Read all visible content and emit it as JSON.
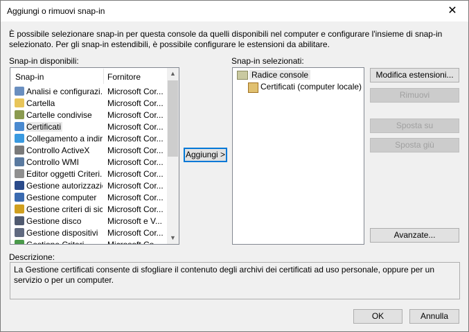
{
  "window": {
    "title": "Aggiungi o rimuovi snap-in",
    "close_glyph": "✕"
  },
  "intro_text": "È possibile selezionare snap-in per questa console da quelli disponibili nel computer e configurare l'insieme di snap-in selezionato. Per gli snap-in estendibili, è possibile configurare le estensioni da abilitare.",
  "available": {
    "label": "Snap-in disponibili:",
    "columns": [
      "Snap-in",
      "Fornitore"
    ],
    "rows": [
      {
        "name": "Analisi e configurazi...",
        "vendor": "Microsoft Cor...",
        "icon": "security-config-icon",
        "color": "#6a8fc0"
      },
      {
        "name": "Cartella",
        "vendor": "Microsoft Cor...",
        "icon": "folder-icon",
        "color": "#e8c55a"
      },
      {
        "name": "Cartelle condivise",
        "vendor": "Microsoft Cor...",
        "icon": "shared-folder-icon",
        "color": "#8a9a50"
      },
      {
        "name": "Certificati",
        "vendor": "Microsoft Cor...",
        "icon": "certificate-icon",
        "color": "#4a8ad0",
        "selected": true
      },
      {
        "name": "Collegamento a indir...",
        "vendor": "Microsoft Cor...",
        "icon": "web-link-icon",
        "color": "#3a9ae0"
      },
      {
        "name": "Controllo ActiveX",
        "vendor": "Microsoft Cor...",
        "icon": "activex-icon",
        "color": "#7a7a7a"
      },
      {
        "name": "Controllo WMI",
        "vendor": "Microsoft Cor...",
        "icon": "wmi-icon",
        "color": "#5a7aa0"
      },
      {
        "name": "Editor oggetti Criteri...",
        "vendor": "Microsoft Cor...",
        "icon": "policy-editor-icon",
        "color": "#909090"
      },
      {
        "name": "Gestione autorizzazioni",
        "vendor": "Microsoft Cor...",
        "icon": "authorization-icon",
        "color": "#2a4a8a"
      },
      {
        "name": "Gestione computer",
        "vendor": "Microsoft Cor...",
        "icon": "computer-management-icon",
        "color": "#3a6ab0"
      },
      {
        "name": "Gestione criteri di sic...",
        "vendor": "Microsoft Cor...",
        "icon": "security-policy-icon",
        "color": "#d0a020"
      },
      {
        "name": "Gestione disco",
        "vendor": "Microsoft e V...",
        "icon": "disk-icon",
        "color": "#505a70"
      },
      {
        "name": "Gestione dispositivi",
        "vendor": "Microsoft Cor...",
        "icon": "device-manager-icon",
        "color": "#606a80"
      },
      {
        "name": "Gestione Criteri...",
        "vendor": "Microsoft Co...",
        "icon": "generic-snapin-icon",
        "color": "#4a9a4a"
      }
    ]
  },
  "add_button": "Aggiungi >",
  "selected": {
    "label": "Snap-in selezionati:",
    "root": "Radice console",
    "child": "Certificati (computer locale)"
  },
  "buttons": {
    "edit_extensions": "Modifica estensioni...",
    "remove": "Rimuovi",
    "move_up": "Sposta su",
    "move_down": "Sposta giù",
    "advanced": "Avanzate...",
    "ok": "OK",
    "cancel": "Annulla"
  },
  "description": {
    "label": "Descrizione:",
    "text": "La Gestione certificati consente di sfogliare il contenuto degli archivi dei certificati ad uso personale, oppure per un servizio o per un computer."
  }
}
